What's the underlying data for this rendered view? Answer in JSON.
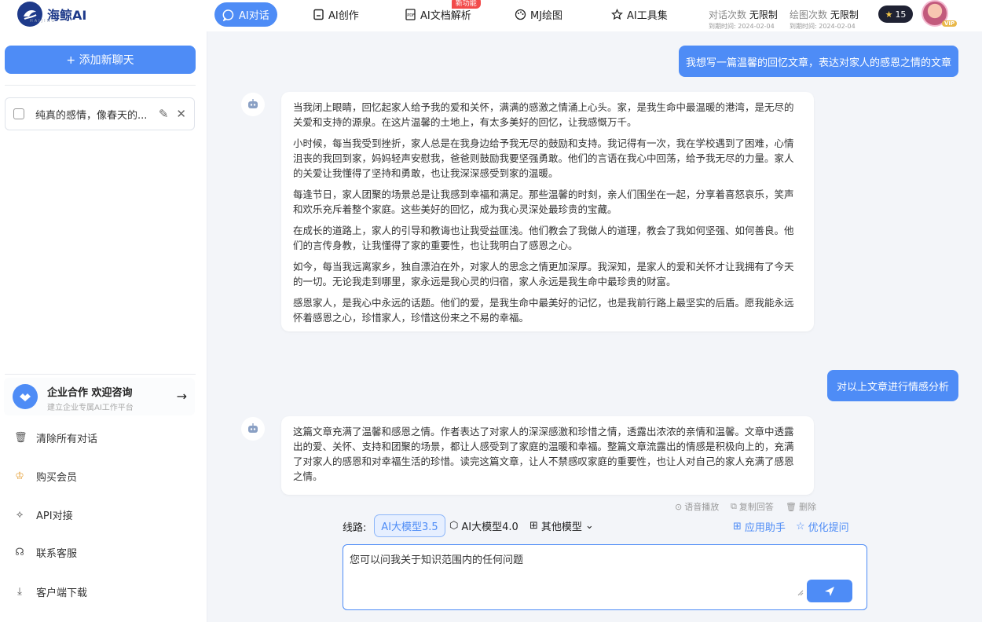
{
  "app": {
    "logo_text": "海鲸AI",
    "logo_sub": "HAIJING"
  },
  "nav": [
    {
      "label": "AI对话",
      "icon": "chat-bubble-icon",
      "active": true
    },
    {
      "label": "AI创作",
      "icon": "document-edit-icon"
    },
    {
      "label": "AI文档解析",
      "icon": "pdf-icon",
      "badge": "新功能"
    },
    {
      "label": "MJ绘图",
      "icon": "palette-icon"
    },
    {
      "label": "AI工具集",
      "icon": "star-outline-icon"
    }
  ],
  "quota": {
    "chat_label": "对话次数",
    "chat_value": "无限制",
    "chat_expiry": "到期时间: 2024-02-04",
    "draw_label": "绘图次数",
    "draw_value": "无限制",
    "draw_expiry": "到期时间: 2024-02-04"
  },
  "user": {
    "stars": "15",
    "vip_label": "VIP"
  },
  "sidebar": {
    "add_chat": "+ 添加新聊天",
    "conversation_title": "纯真的感情，像春天的...",
    "business": {
      "title": "企业合作 欢迎咨询",
      "subtitle": "建立企业专属AI工作平台"
    },
    "items": [
      {
        "label": "清除所有对话",
        "icon": "trash-icon"
      },
      {
        "label": "购买会员",
        "icon": "crown-icon"
      },
      {
        "label": "API对接",
        "icon": "api-icon"
      },
      {
        "label": "联系客服",
        "icon": "headset-icon"
      },
      {
        "label": "客户端下载",
        "icon": "download-icon"
      }
    ]
  },
  "chat": {
    "user_msg_1": "我想写一篇温馨的回忆文章，表达对家人的感恩之情的文章",
    "bot_msg_1": [
      "当我闭上眼睛，回忆起家人给予我的爱和关怀，满满的感激之情涌上心头。家，是我生命中最温暖的港湾，是无尽的关爱和支持的源泉。在这片温馨的土地上，有太多美好的回忆，让我感慨万千。",
      "小时候，每当我受到挫折，家人总是在我身边给予我无尽的鼓励和支持。我记得有一次，我在学校遇到了困难，心情沮丧的我回到家，妈妈轻声安慰我，爸爸则鼓励我要坚强勇敢。他们的言语在我心中回荡，给予我无尽的力量。家人的关爱让我懂得了坚持和勇敢，也让我深深感受到家的温暖。",
      "每逢节日，家人团聚的场景总是让我感到幸福和满足。那些温馨的时刻，亲人们围坐在一起，分享着喜怒哀乐，笑声和欢乐充斥着整个家庭。这些美好的回忆，成为我心灵深处最珍贵的宝藏。",
      "在成长的道路上，家人的引导和教诲也让我受益匪浅。他们教会了我做人的道理，教会了我如何坚强、如何善良。他们的言传身教，让我懂得了家的重要性，也让我明白了感恩之心。",
      "如今，每当我远离家乡，独自漂泊在外，对家人的思念之情更加深厚。我深知，是家人的爱和关怀才让我拥有了今天的一切。无论我走到哪里，家永远是我心灵的归宿，家人永远是我生命中最珍贵的财富。",
      "感恩家人，是我心中永远的话题。他们的爱，是我生命中最美好的记忆，也是我前行路上最坚实的后盾。愿我能永远怀着感恩之心，珍惜家人，珍惜这份来之不易的幸福。"
    ],
    "user_msg_2": "对以上文章进行情感分析",
    "bot_msg_2": "这篇文章充满了温馨和感恩之情。作者表达了对家人的深深感激和珍惜之情，透露出浓浓的亲情和温馨。文章中透露出的爱、关怀、支持和团聚的场景，都让人感受到了家庭的温暖和幸福。整篇文章流露出的情感是积极向上的，充满了对家人的感恩和对幸福生活的珍惜。读完这篇文章，让人不禁感叹家庭的重要性，也让人对自己的家人充满了感恩之情。",
    "tools": {
      "speak": "语音播放",
      "copy": "复制回答",
      "delete": "删除"
    }
  },
  "composer": {
    "route_label": "线路:",
    "model_active": "AI大模型3.5",
    "model_alt": "AI大模型4.0",
    "other_models": "其他模型",
    "app_helper": "应用助手",
    "optimize": "优化提问",
    "placeholder": "您可以问我关于知识范围内的任何问题"
  },
  "colors": {
    "accent": "#4e8cf6",
    "background": "#f3f5f9",
    "badge": "#f24a4a"
  }
}
